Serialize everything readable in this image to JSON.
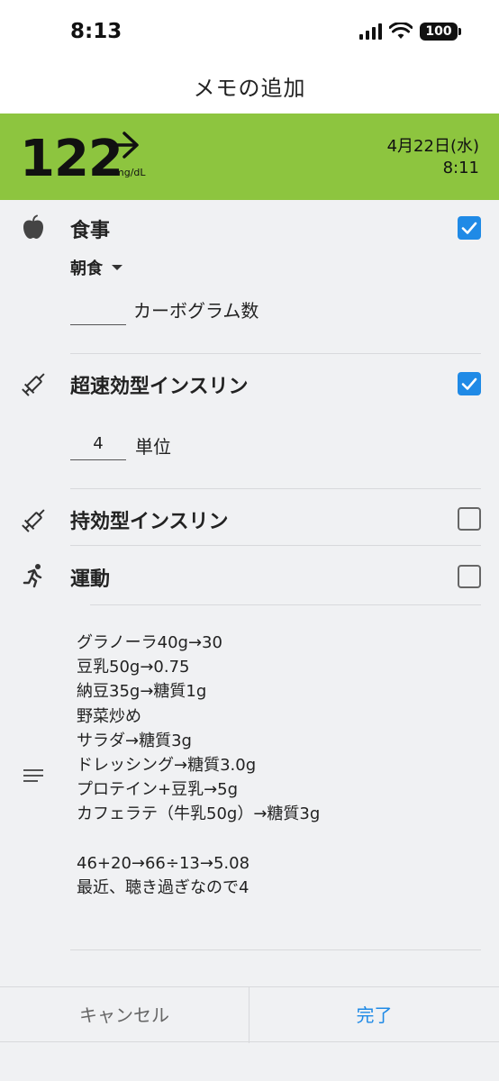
{
  "status_bar": {
    "time": "8:13",
    "battery": "100"
  },
  "header": {
    "title": "メモの追加"
  },
  "glucose": {
    "value": "122",
    "unit": "mg/dL",
    "date": "4月22日(水)",
    "time": "8:11"
  },
  "meal": {
    "label": "食事",
    "checked": true,
    "meal_type": "朝食",
    "carbs_value": "",
    "carbs_label": "カーボグラム数"
  },
  "rapid_insulin": {
    "label": "超速効型インスリン",
    "checked": true,
    "units_value": "4",
    "units_label": "単位"
  },
  "long_insulin": {
    "label": "持効型インスリン",
    "checked": false
  },
  "exercise": {
    "label": "運動",
    "checked": false
  },
  "note": {
    "text": "グラノーラ40g→30\n豆乳50g→0.75\n納豆35g→糖質1g\n野菜炒め\nサラダ→糖質3g\nドレッシング→糖質3.0g\nプロテイン+豆乳→5g\nカフェラテ（牛乳50g）→糖質3g\n\n46+20→66÷13→5.08\n最近、聴き過ぎなので4"
  },
  "footer": {
    "cancel_label": "キャンセル",
    "done_label": "完了"
  },
  "colors": {
    "banner_bg": "#8dc53f",
    "accent": "#1f8ae6"
  }
}
